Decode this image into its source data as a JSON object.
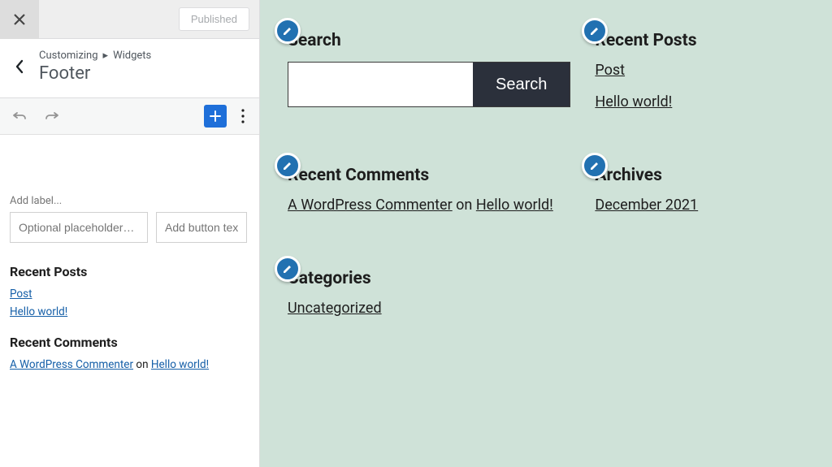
{
  "sidebar": {
    "published_label": "Published",
    "breadcrumb_prefix": "Customizing",
    "breadcrumb_sep": "▸",
    "breadcrumb_item": "Widgets",
    "page_title": "Footer",
    "add_label_heading": "Add label...",
    "placeholder_input": "Optional placeholder…",
    "button_text_input": "Add button text…",
    "recent_posts_heading": "Recent Posts",
    "posts": [
      "Post",
      "Hello world!"
    ],
    "recent_comments_heading": "Recent Comments",
    "comment_author": "A WordPress Commenter",
    "comment_on": " on ",
    "comment_post": "Hello world!"
  },
  "preview": {
    "search": {
      "heading": "Search",
      "button": "Search"
    },
    "recent_posts": {
      "heading": "Recent Posts",
      "items": [
        "Post",
        "Hello world!"
      ]
    },
    "recent_comments": {
      "heading": "Recent Comments",
      "author": "A WordPress Commenter",
      "on": " on ",
      "post": "Hello world!"
    },
    "archives": {
      "heading": "Archives",
      "items": [
        "December 2021"
      ]
    },
    "categories": {
      "heading": "Categories",
      "items": [
        "Uncategorized"
      ]
    }
  }
}
